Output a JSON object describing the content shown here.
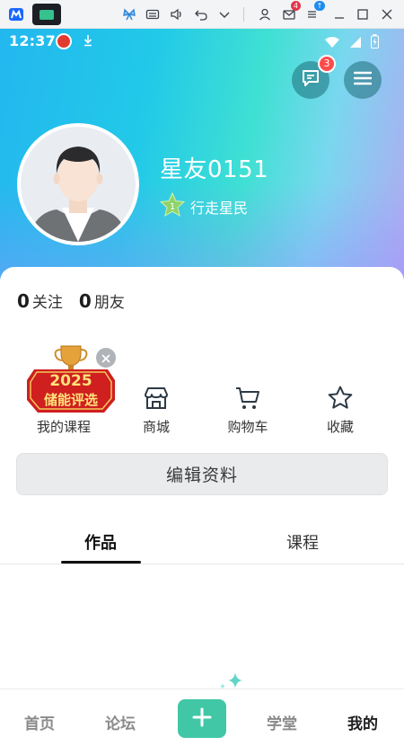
{
  "status_bar": {
    "time": "12:37"
  },
  "header": {
    "message_badge": "3"
  },
  "profile": {
    "username": "星友0151",
    "level_label": "行走星民",
    "following_count": "0",
    "following_label": "关注",
    "friends_count": "0",
    "friends_label": "朋友"
  },
  "promo": {
    "year": "2025",
    "text": "储能评选"
  },
  "quick_links": [
    {
      "label": "我的课程",
      "icon": "book-icon"
    },
    {
      "label": "商城",
      "icon": "store-icon"
    },
    {
      "label": "购物车",
      "icon": "cart-icon"
    },
    {
      "label": "收藏",
      "icon": "star-icon"
    }
  ],
  "edit_profile_label": "编辑资料",
  "tabs": [
    {
      "label": "作品",
      "active": true
    },
    {
      "label": "课程",
      "active": false
    }
  ],
  "bottom_nav": [
    {
      "label": "首页",
      "active": false
    },
    {
      "label": "论坛",
      "active": false
    },
    {
      "label": "学堂",
      "active": false
    },
    {
      "label": "我的",
      "active": true
    }
  ],
  "emulator": {
    "mail_badge": "4"
  },
  "colors": {
    "accent": "#41c7a6",
    "badge": "#ff4a4a",
    "gradient_start": "#23b7ef",
    "gradient_end": "#b3a8f2"
  }
}
